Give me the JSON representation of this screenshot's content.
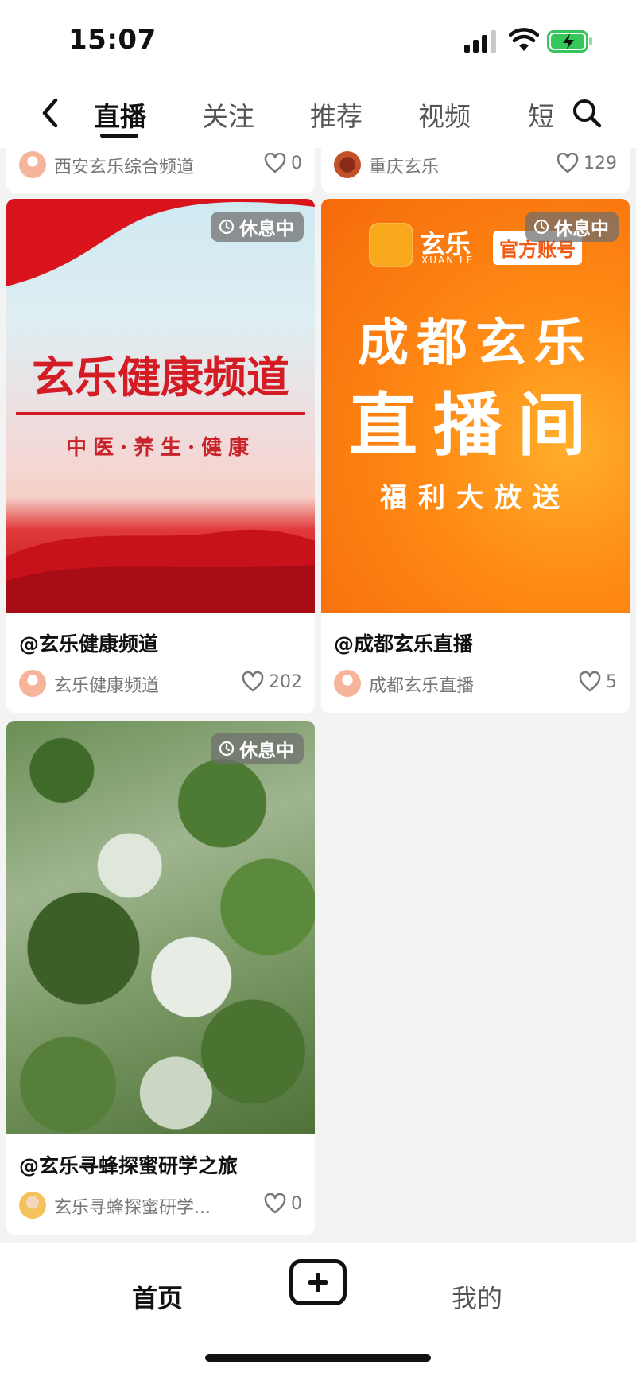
{
  "status_bar": {
    "time": "15:07"
  },
  "nav": {
    "tabs": [
      {
        "label": "直播",
        "active": true
      },
      {
        "label": "关注",
        "active": false
      },
      {
        "label": "推荐",
        "active": false
      },
      {
        "label": "视频",
        "active": false
      },
      {
        "label": "短",
        "active": false
      }
    ]
  },
  "top_partial_cards": [
    {
      "author": "西安玄乐综合频道",
      "likes": "0"
    },
    {
      "author": "重庆玄乐",
      "likes": "129"
    }
  ],
  "cards": [
    {
      "badge": "休息中",
      "poster_title": "玄乐健康频道",
      "poster_subtitle": "中医·养生·健康",
      "title": "@玄乐健康频道",
      "author": "玄乐健康频道",
      "likes": "202"
    },
    {
      "badge": "休息中",
      "logo_text": "玄乐",
      "logo_sub": "XUAN LE",
      "official_tag": "官方账号",
      "poster_line1": "成都玄乐",
      "poster_line2": "直播间",
      "poster_line3": "福利大放送",
      "title": "@成都玄乐直播",
      "author": "成都玄乐直播",
      "likes": "5"
    },
    {
      "badge": "休息中",
      "title": "@玄乐寻蜂探蜜研学之旅",
      "author": "玄乐寻蜂探蜜研学...",
      "likes": "0"
    }
  ],
  "bottom_bar": {
    "home_label": "首页",
    "mine_label": "我的"
  },
  "colors": {
    "accent_red": "#d41c25",
    "orange": "#f56a0b",
    "badge_bg": "#6e6e6e"
  }
}
